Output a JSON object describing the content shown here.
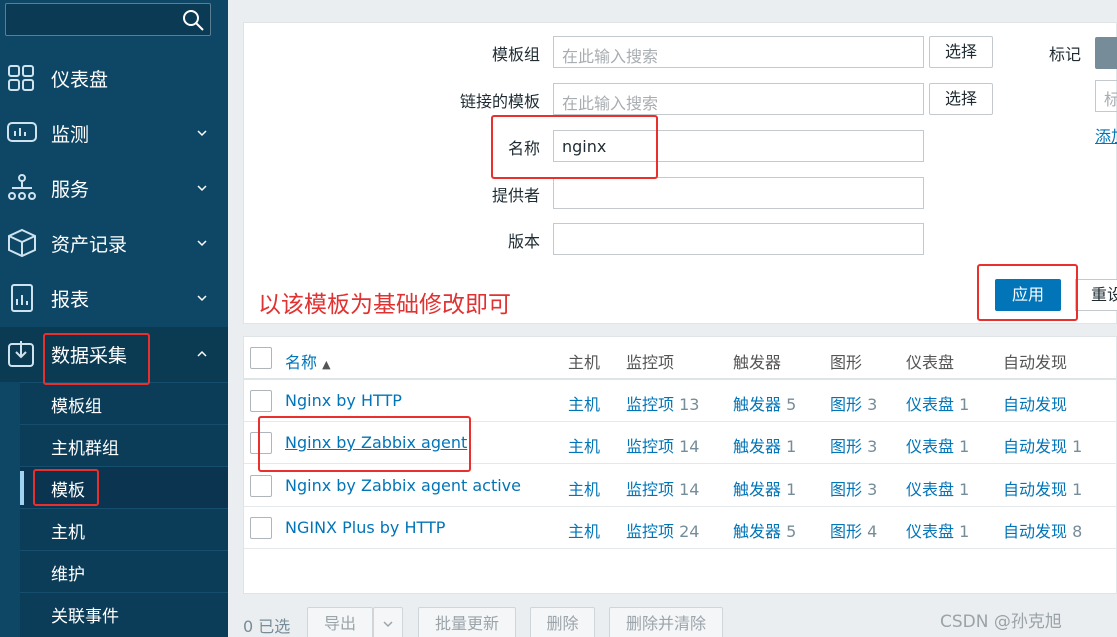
{
  "sidebar": {
    "search_placeholder": "",
    "nav": [
      {
        "label": "仪表盘",
        "icon": "dashboard-icon"
      },
      {
        "label": "监测",
        "icon": "monitoring-icon"
      },
      {
        "label": "服务",
        "icon": "services-icon"
      },
      {
        "label": "资产记录",
        "icon": "inventory-icon"
      },
      {
        "label": "报表",
        "icon": "reports-icon"
      },
      {
        "label": "数据采集",
        "icon": "data-collection-icon"
      }
    ],
    "submenu": [
      {
        "label": "模板组"
      },
      {
        "label": "主机群组"
      },
      {
        "label": "模板"
      },
      {
        "label": "主机"
      },
      {
        "label": "维护"
      },
      {
        "label": "关联事件"
      }
    ]
  },
  "filter": {
    "template_group_label": "模板组",
    "template_group_placeholder": "在此输入搜索",
    "linked_templates_label": "链接的模板",
    "linked_templates_placeholder": "在此输入搜索",
    "select_label": "选择",
    "name_label": "名称",
    "name_value": "nginx",
    "vendor_label": "提供者",
    "vendor_value": "",
    "version_label": "版本",
    "version_value": "",
    "tags_label": "标记",
    "tags_input_placeholder": "标",
    "tags_add_label": "添加",
    "apply_label": "应用",
    "reset_label": "重设",
    "annotation": "以该模板为基础修改即可"
  },
  "table": {
    "headers": {
      "name": "名称",
      "hosts": "主机",
      "items": "监控项",
      "triggers": "触发器",
      "graphs": "图形",
      "dashboards": "仪表盘",
      "discovery": "自动发现"
    },
    "rows": [
      {
        "name": "Nginx by HTTP",
        "hosts": "主机",
        "items": "监控项",
        "items_count": "13",
        "triggers": "触发器",
        "triggers_count": "5",
        "graphs": "图形",
        "graphs_count": "3",
        "dashboards": "仪表盘",
        "dashboards_count": "1",
        "discovery": "自动发现",
        "discovery_count": ""
      },
      {
        "name": "Nginx by Zabbix agent",
        "hosts": "主机",
        "items": "监控项",
        "items_count": "14",
        "triggers": "触发器",
        "triggers_count": "1",
        "graphs": "图形",
        "graphs_count": "3",
        "dashboards": "仪表盘",
        "dashboards_count": "1",
        "discovery": "自动发现",
        "discovery_count": "1"
      },
      {
        "name": "Nginx by Zabbix agent active",
        "hosts": "主机",
        "items": "监控项",
        "items_count": "14",
        "triggers": "触发器",
        "triggers_count": "1",
        "graphs": "图形",
        "graphs_count": "3",
        "dashboards": "仪表盘",
        "dashboards_count": "1",
        "discovery": "自动发现",
        "discovery_count": "1"
      },
      {
        "name": "NGINX Plus by HTTP",
        "hosts": "主机",
        "items": "监控项",
        "items_count": "24",
        "triggers": "触发器",
        "triggers_count": "5",
        "graphs": "图形",
        "graphs_count": "4",
        "dashboards": "仪表盘",
        "dashboards_count": "1",
        "discovery": "自动发现",
        "discovery_count": "8"
      }
    ]
  },
  "footer": {
    "selected": "0 已选",
    "export": "导出",
    "mass_update": "批量更新",
    "delete": "删除",
    "delete_clear": "删除并清除"
  },
  "watermark": "CSDN @孙克旭"
}
